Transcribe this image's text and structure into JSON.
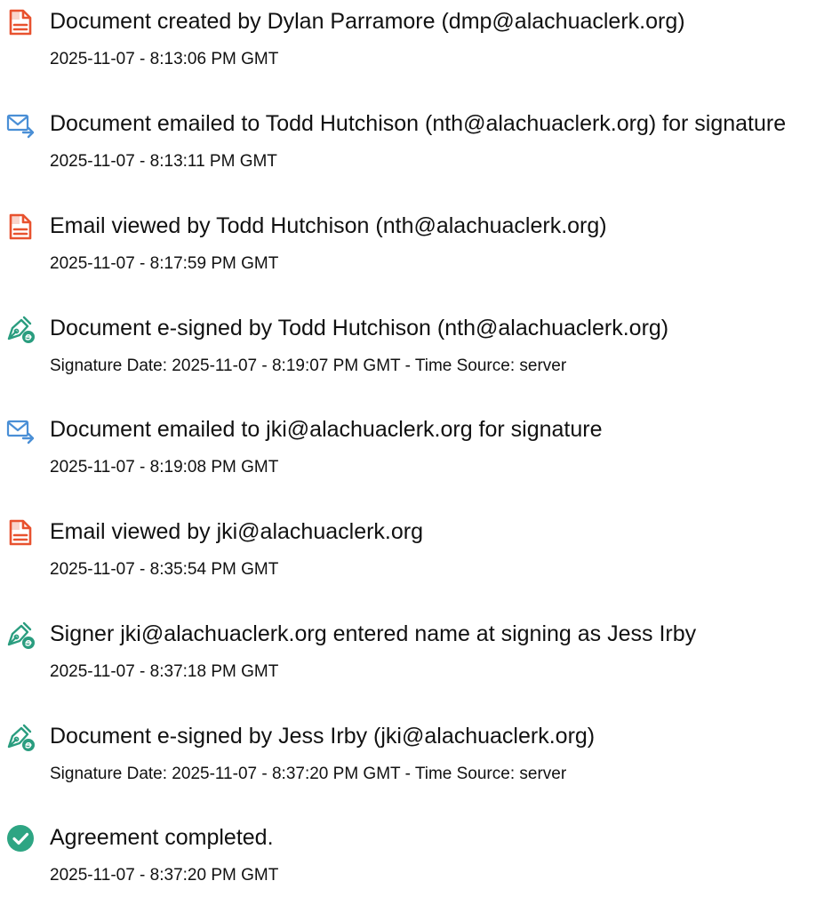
{
  "events": [
    {
      "icon": "document-created-icon",
      "title": "Document created by Dylan Parramore (dmp@alachuaclerk.org)",
      "timestamp": "2025-11-07 - 8:13:06 PM GMT"
    },
    {
      "icon": "document-emailed-icon",
      "title": "Document emailed to Todd Hutchison (nth@alachuaclerk.org) for signature",
      "timestamp": "2025-11-07 - 8:13:11 PM GMT"
    },
    {
      "icon": "email-viewed-icon",
      "title": "Email viewed by Todd Hutchison (nth@alachuaclerk.org)",
      "timestamp": "2025-11-07 - 8:17:59 PM GMT"
    },
    {
      "icon": "e-signed-icon",
      "title": "Document e-signed by Todd Hutchison (nth@alachuaclerk.org)",
      "timestamp": "Signature Date: 2025-11-07 - 8:19:07 PM GMT - Time Source: server"
    },
    {
      "icon": "document-emailed-icon",
      "title": "Document emailed to jki@alachuaclerk.org for signature",
      "timestamp": "2025-11-07 - 8:19:08 PM GMT"
    },
    {
      "icon": "email-viewed-icon",
      "title": "Email viewed by jki@alachuaclerk.org",
      "timestamp": "2025-11-07 - 8:35:54 PM GMT"
    },
    {
      "icon": "e-signed-icon",
      "title": "Signer jki@alachuaclerk.org entered name at signing as Jess Irby",
      "timestamp": "2025-11-07 - 8:37:18 PM GMT"
    },
    {
      "icon": "e-signed-icon",
      "title": "Document e-signed by Jess Irby (jki@alachuaclerk.org)",
      "timestamp": "Signature Date: 2025-11-07 - 8:37:20 PM GMT - Time Source: server"
    },
    {
      "icon": "agreement-completed-icon",
      "title": "Agreement completed.",
      "timestamp": "2025-11-07 - 8:37:20 PM GMT"
    }
  ],
  "colors": {
    "document_icon": "#e8522f",
    "email_icon": "#4a8fd6",
    "signed_icon": "#2a9d7f",
    "completed_icon": "#2ea583",
    "text": "#111111"
  }
}
